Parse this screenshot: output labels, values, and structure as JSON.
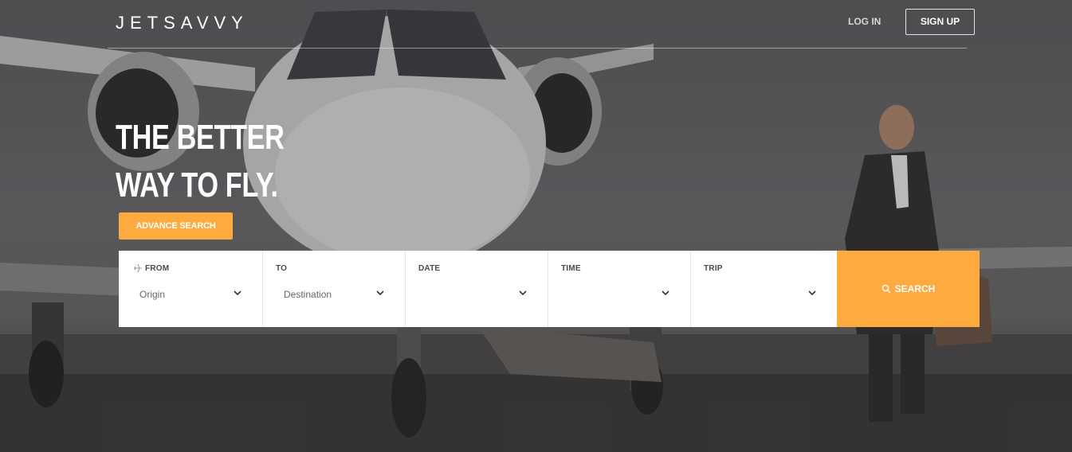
{
  "header": {
    "logo": "JETSAVVY",
    "login_label": "LOG IN",
    "signup_label": "SIGN UP"
  },
  "hero": {
    "headline_line1": "THE BETTER",
    "headline_line2": "WAY TO FLY.",
    "advance_search_label": "ADVANCE SEARCH"
  },
  "search": {
    "fields": [
      {
        "label": "FROM",
        "value": "Origin",
        "icon": "plane-icon"
      },
      {
        "label": "TO",
        "value": "Destination"
      },
      {
        "label": "DATE",
        "value": ""
      },
      {
        "label": "TIME",
        "value": ""
      },
      {
        "label": "TRIP",
        "value": ""
      }
    ],
    "button_label": "SEARCH",
    "button_icon": "search-icon"
  },
  "colors": {
    "accent": "#ffab40",
    "field_bg": "#ffffff"
  }
}
